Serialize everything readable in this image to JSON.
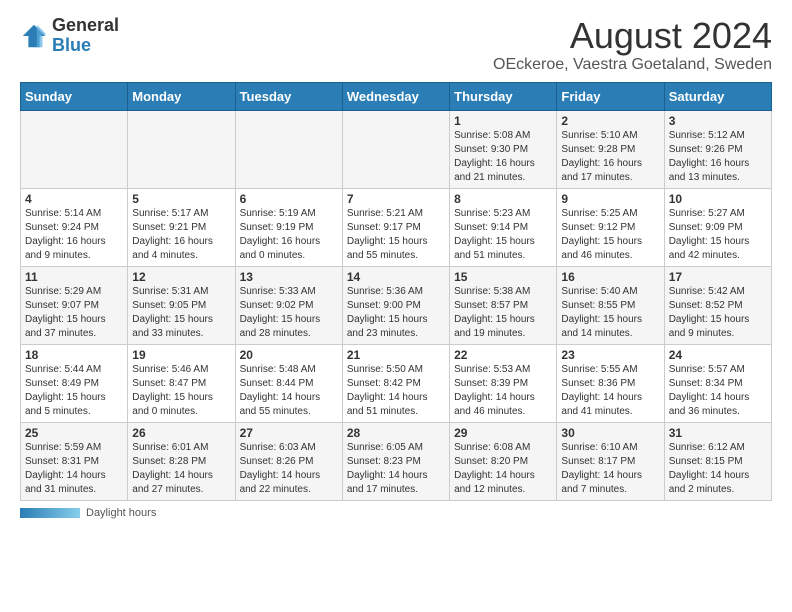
{
  "logo": {
    "general": "General",
    "blue": "Blue"
  },
  "title": "August 2024",
  "subtitle": "OEckeroe, Vaestra Goetaland, Sweden",
  "days_of_week": [
    "Sunday",
    "Monday",
    "Tuesday",
    "Wednesday",
    "Thursday",
    "Friday",
    "Saturday"
  ],
  "footer_label": "Daylight hours",
  "weeks": [
    [
      {
        "num": "",
        "info": ""
      },
      {
        "num": "",
        "info": ""
      },
      {
        "num": "",
        "info": ""
      },
      {
        "num": "",
        "info": ""
      },
      {
        "num": "1",
        "info": "Sunrise: 5:08 AM\nSunset: 9:30 PM\nDaylight: 16 hours\nand 21 minutes."
      },
      {
        "num": "2",
        "info": "Sunrise: 5:10 AM\nSunset: 9:28 PM\nDaylight: 16 hours\nand 17 minutes."
      },
      {
        "num": "3",
        "info": "Sunrise: 5:12 AM\nSunset: 9:26 PM\nDaylight: 16 hours\nand 13 minutes."
      }
    ],
    [
      {
        "num": "4",
        "info": "Sunrise: 5:14 AM\nSunset: 9:24 PM\nDaylight: 16 hours\nand 9 minutes."
      },
      {
        "num": "5",
        "info": "Sunrise: 5:17 AM\nSunset: 9:21 PM\nDaylight: 16 hours\nand 4 minutes."
      },
      {
        "num": "6",
        "info": "Sunrise: 5:19 AM\nSunset: 9:19 PM\nDaylight: 16 hours\nand 0 minutes."
      },
      {
        "num": "7",
        "info": "Sunrise: 5:21 AM\nSunset: 9:17 PM\nDaylight: 15 hours\nand 55 minutes."
      },
      {
        "num": "8",
        "info": "Sunrise: 5:23 AM\nSunset: 9:14 PM\nDaylight: 15 hours\nand 51 minutes."
      },
      {
        "num": "9",
        "info": "Sunrise: 5:25 AM\nSunset: 9:12 PM\nDaylight: 15 hours\nand 46 minutes."
      },
      {
        "num": "10",
        "info": "Sunrise: 5:27 AM\nSunset: 9:09 PM\nDaylight: 15 hours\nand 42 minutes."
      }
    ],
    [
      {
        "num": "11",
        "info": "Sunrise: 5:29 AM\nSunset: 9:07 PM\nDaylight: 15 hours\nand 37 minutes."
      },
      {
        "num": "12",
        "info": "Sunrise: 5:31 AM\nSunset: 9:05 PM\nDaylight: 15 hours\nand 33 minutes."
      },
      {
        "num": "13",
        "info": "Sunrise: 5:33 AM\nSunset: 9:02 PM\nDaylight: 15 hours\nand 28 minutes."
      },
      {
        "num": "14",
        "info": "Sunrise: 5:36 AM\nSunset: 9:00 PM\nDaylight: 15 hours\nand 23 minutes."
      },
      {
        "num": "15",
        "info": "Sunrise: 5:38 AM\nSunset: 8:57 PM\nDaylight: 15 hours\nand 19 minutes."
      },
      {
        "num": "16",
        "info": "Sunrise: 5:40 AM\nSunset: 8:55 PM\nDaylight: 15 hours\nand 14 minutes."
      },
      {
        "num": "17",
        "info": "Sunrise: 5:42 AM\nSunset: 8:52 PM\nDaylight: 15 hours\nand 9 minutes."
      }
    ],
    [
      {
        "num": "18",
        "info": "Sunrise: 5:44 AM\nSunset: 8:49 PM\nDaylight: 15 hours\nand 5 minutes."
      },
      {
        "num": "19",
        "info": "Sunrise: 5:46 AM\nSunset: 8:47 PM\nDaylight: 15 hours\nand 0 minutes."
      },
      {
        "num": "20",
        "info": "Sunrise: 5:48 AM\nSunset: 8:44 PM\nDaylight: 14 hours\nand 55 minutes."
      },
      {
        "num": "21",
        "info": "Sunrise: 5:50 AM\nSunset: 8:42 PM\nDaylight: 14 hours\nand 51 minutes."
      },
      {
        "num": "22",
        "info": "Sunrise: 5:53 AM\nSunset: 8:39 PM\nDaylight: 14 hours\nand 46 minutes."
      },
      {
        "num": "23",
        "info": "Sunrise: 5:55 AM\nSunset: 8:36 PM\nDaylight: 14 hours\nand 41 minutes."
      },
      {
        "num": "24",
        "info": "Sunrise: 5:57 AM\nSunset: 8:34 PM\nDaylight: 14 hours\nand 36 minutes."
      }
    ],
    [
      {
        "num": "25",
        "info": "Sunrise: 5:59 AM\nSunset: 8:31 PM\nDaylight: 14 hours\nand 31 minutes."
      },
      {
        "num": "26",
        "info": "Sunrise: 6:01 AM\nSunset: 8:28 PM\nDaylight: 14 hours\nand 27 minutes."
      },
      {
        "num": "27",
        "info": "Sunrise: 6:03 AM\nSunset: 8:26 PM\nDaylight: 14 hours\nand 22 minutes."
      },
      {
        "num": "28",
        "info": "Sunrise: 6:05 AM\nSunset: 8:23 PM\nDaylight: 14 hours\nand 17 minutes."
      },
      {
        "num": "29",
        "info": "Sunrise: 6:08 AM\nSunset: 8:20 PM\nDaylight: 14 hours\nand 12 minutes."
      },
      {
        "num": "30",
        "info": "Sunrise: 6:10 AM\nSunset: 8:17 PM\nDaylight: 14 hours\nand 7 minutes."
      },
      {
        "num": "31",
        "info": "Sunrise: 6:12 AM\nSunset: 8:15 PM\nDaylight: 14 hours\nand 2 minutes."
      }
    ]
  ]
}
